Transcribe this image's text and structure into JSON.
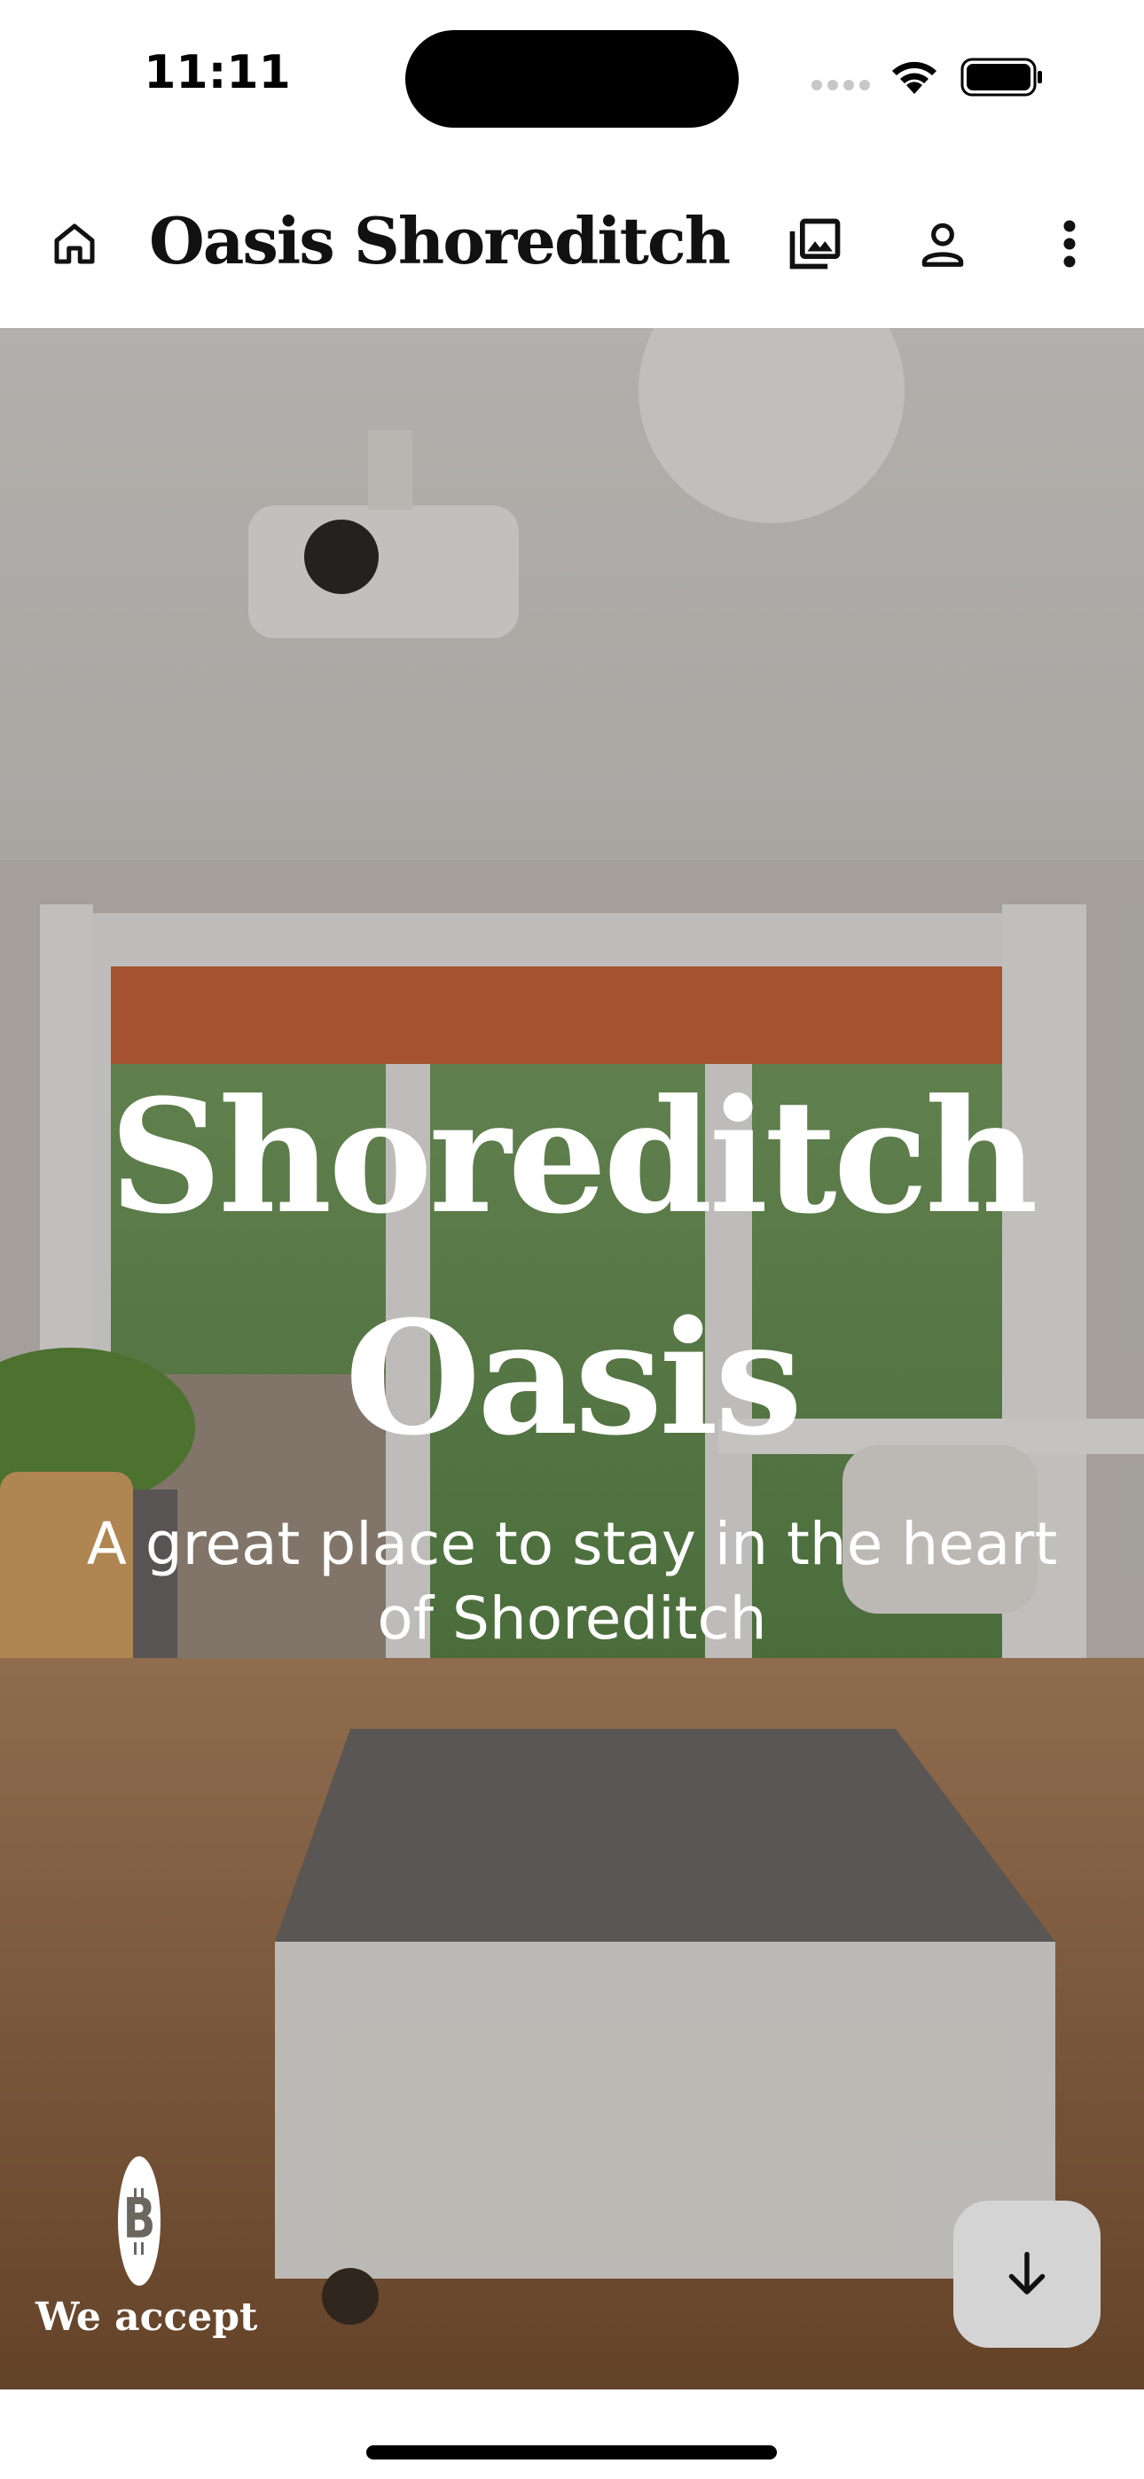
{
  "status_bar": {
    "time": "11:11"
  },
  "header": {
    "home_icon": "home-icon",
    "title": "Oasis Shoreditch",
    "gallery_icon": "photo-library-icon",
    "account_icon": "person-icon",
    "more_icon": "more-vert-icon"
  },
  "hero": {
    "title": "Shoreditch Oasis",
    "subtitle": "A great place to stay in the heart of Shoreditch",
    "payment_label": "We accept",
    "payment_icon": "bitcoin-icon",
    "scroll_icon": "arrow-down-icon"
  },
  "colors": {
    "header_background": "#ffffff",
    "title_text": "#111111",
    "hero_text": "#ffffff",
    "scroll_button": "#d4d4d4"
  }
}
